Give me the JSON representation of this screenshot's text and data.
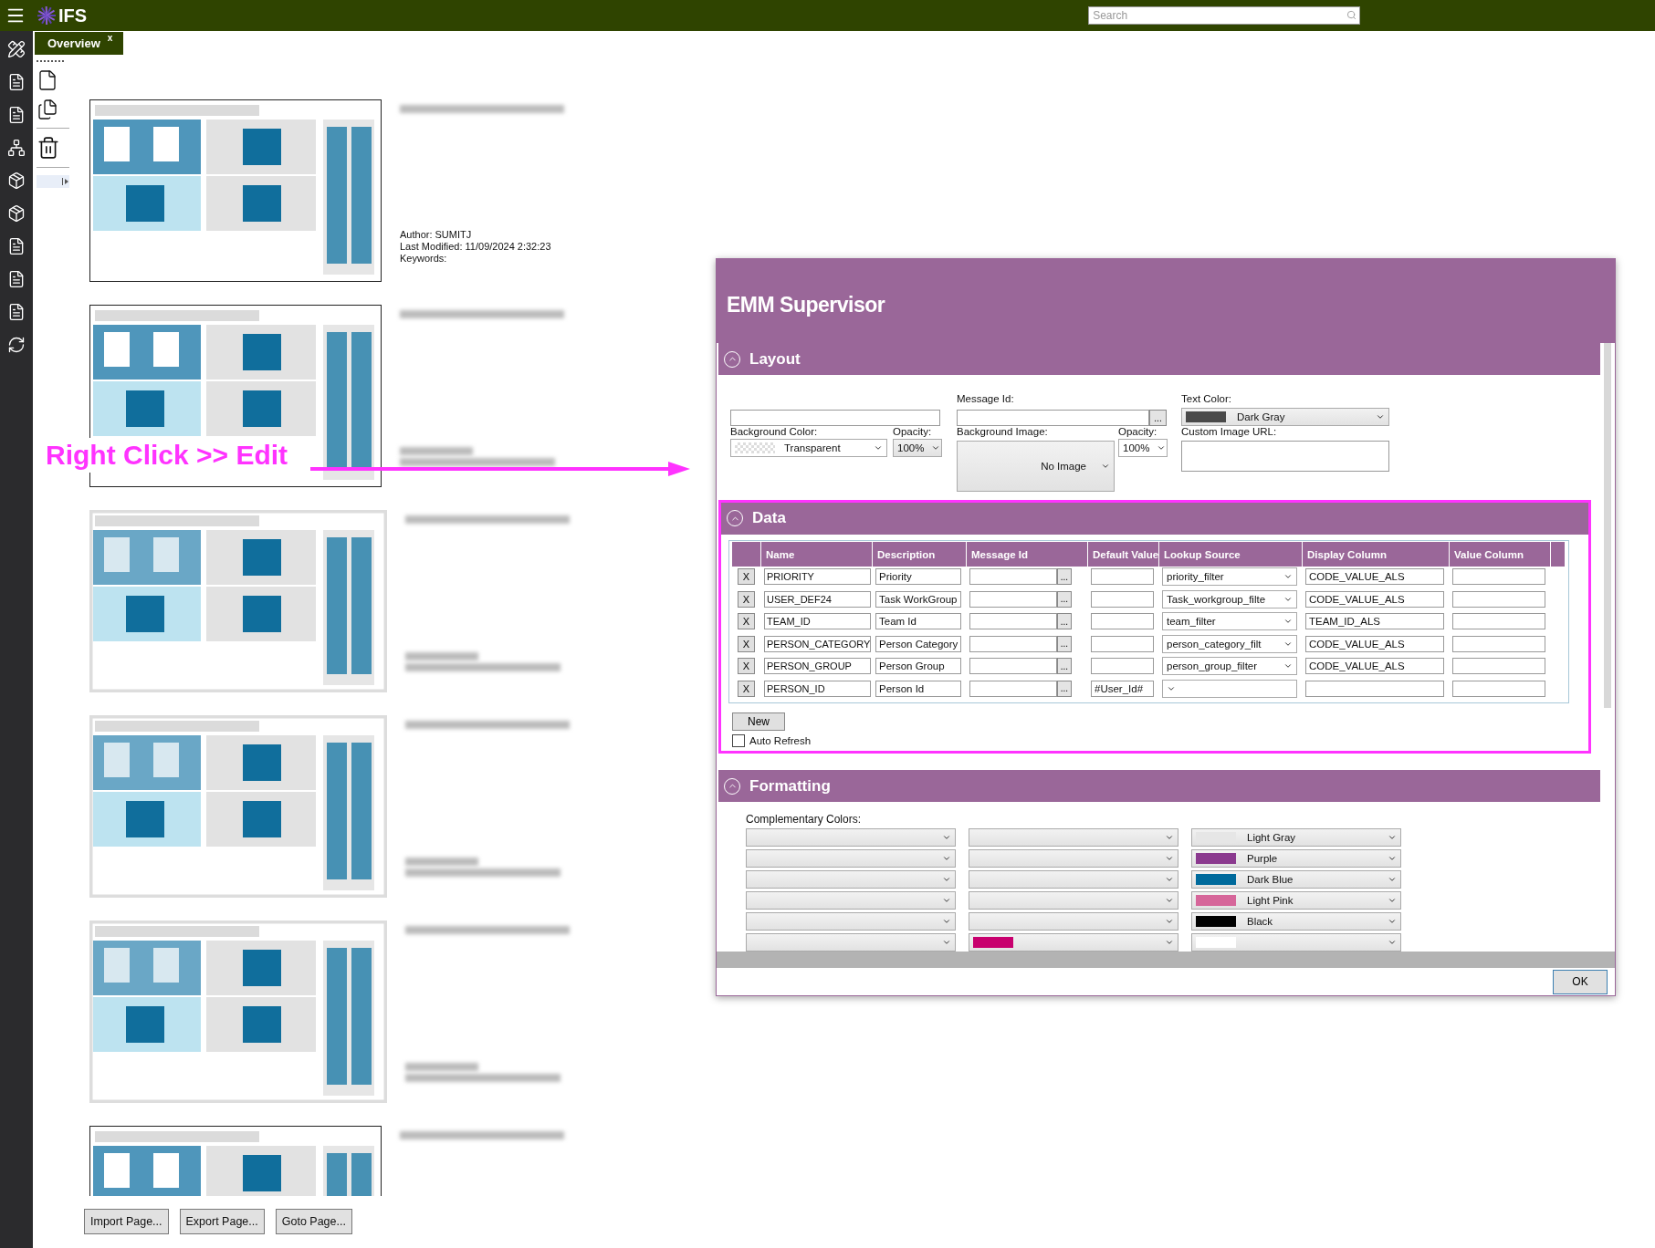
{
  "top_bar": {
    "logo_text": "IFS",
    "search": {
      "placeholder": "Search"
    }
  },
  "tabs": [
    {
      "label": "Overview",
      "close": "x",
      "selected": true
    }
  ],
  "pages": [
    {
      "kind": "sharp",
      "author": "Author: SUMITJ",
      "modified": "Last Modified: 11/09/2024 2:32:23",
      "keywords": "Keywords:"
    },
    {
      "kind": "sharp"
    },
    {
      "kind": "blurred"
    },
    {
      "kind": "blurred"
    },
    {
      "kind": "blurred"
    },
    {
      "kind": "partial"
    }
  ],
  "buttons": [
    "Import Page...",
    "Export Page...",
    "Goto Page..."
  ],
  "annotation": {
    "text": "Right Click >> Edit"
  },
  "dialog": {
    "title": "EMM Supervisor",
    "layout": {
      "title": "Layout",
      "expanded": true,
      "message_id_label": "Message Id:",
      "message_id_button": "...",
      "text_color_label": "Text Color:",
      "text_color": {
        "label": "Dark Gray",
        "color": "#4a4a4a"
      },
      "background_color_label": "Background Color:",
      "background_color": "Transparent",
      "opacity_label": "Opacity:",
      "opacity": "100%",
      "background_image_label": "Background Image:",
      "background_image": "No Image",
      "image_opacity_label": "Opacity:",
      "image_opacity": "100%",
      "custom_image_url_label": "Custom Image URL:"
    },
    "data": {
      "title": "Data",
      "expanded": true,
      "columns": [
        "Name",
        "Description",
        "Message Id",
        "Default Value",
        "Lookup Source",
        "Display Column",
        "Value Column"
      ],
      "rows": [
        {
          "remove": "X",
          "name": "PRIORITY",
          "description": "Priority",
          "message_id_button": "...",
          "lookup_source": "priority_filter",
          "display_column": "CODE_VALUE_ALS"
        },
        {
          "remove": "X",
          "name": "USER_DEF24",
          "description": "Task WorkGroup",
          "message_id_button": "...",
          "lookup_source": "Task_workgroup_filte",
          "display_column": "CODE_VALUE_ALS"
        },
        {
          "remove": "X",
          "name": "TEAM_ID",
          "description": "Team Id",
          "message_id_button": "...",
          "lookup_source": "team_filter",
          "display_column": "TEAM_ID_ALS"
        },
        {
          "remove": "X",
          "name": "PERSON_CATEGORY",
          "description": "Person Category",
          "message_id_button": "...",
          "lookup_source": "person_category_filt",
          "display_column": "CODE_VALUE_ALS"
        },
        {
          "remove": "X",
          "name": "PERSON_GROUP",
          "description": "Person Group",
          "message_id_button": "...",
          "lookup_source": "person_group_filter",
          "display_column": "CODE_VALUE_ALS"
        },
        {
          "remove": "X",
          "name": "PERSON_ID",
          "description": "Person Id",
          "message_id_button": "...",
          "default_value": "#User_Id#"
        }
      ],
      "new_button": "New",
      "auto_refresh": {
        "label": "Auto Refresh",
        "checked": false
      }
    },
    "formatting": {
      "title": "Formatting",
      "expanded": true,
      "label": "Complementary Colors:",
      "rows": [
        [
          {},
          {},
          {
            "label": "Light Gray",
            "color": "#e6e6e6"
          }
        ],
        [
          {},
          {},
          {
            "label": "Purple",
            "color": "#8b3a8f"
          }
        ],
        [
          {},
          {},
          {
            "label": "Dark Blue",
            "color": "#006a9c"
          }
        ],
        [
          {},
          {},
          {
            "label": "Light Pink",
            "color": "#d6669a"
          }
        ],
        [
          {},
          {},
          {
            "label": "Black",
            "color": "#000000"
          }
        ],
        [
          {},
          {
            "color": "#c8006e"
          },
          {
            "color": "#ffffff"
          }
        ]
      ]
    },
    "ok_button": "OK"
  }
}
